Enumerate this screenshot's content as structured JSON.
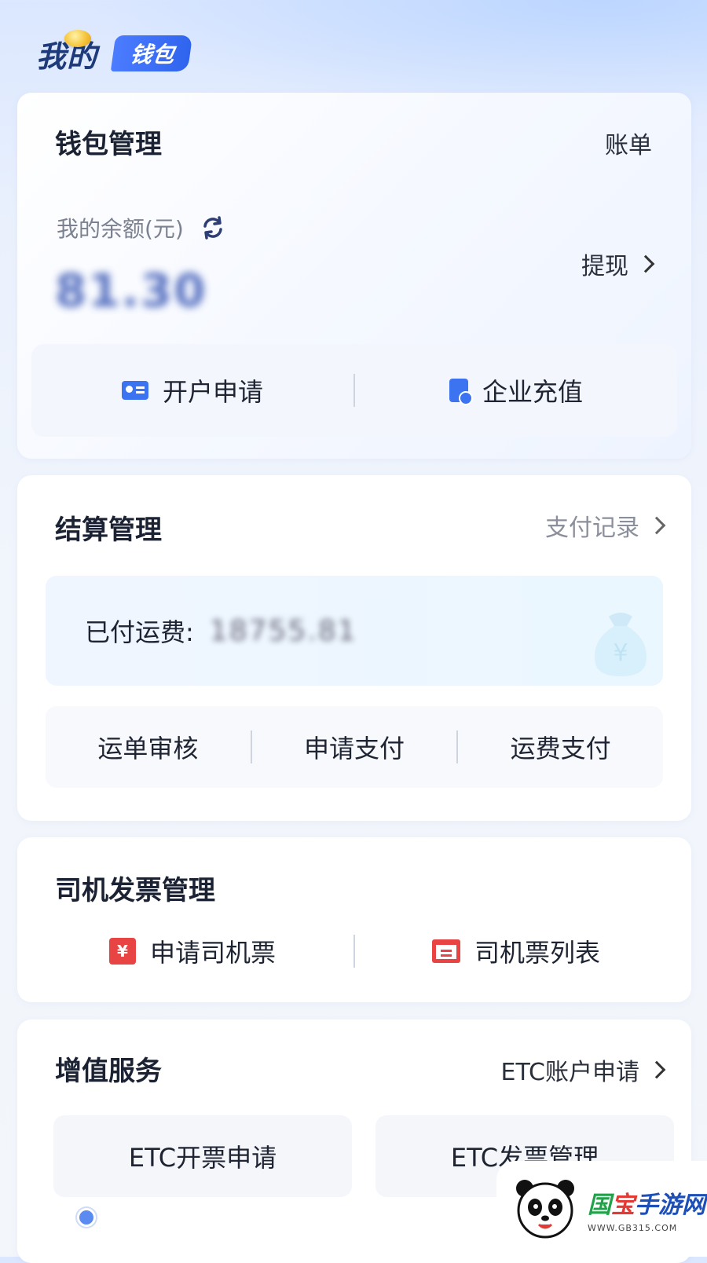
{
  "header": {
    "title": "我的",
    "badge": "钱包"
  },
  "wallet": {
    "title": "钱包管理",
    "bill_link": "账单",
    "balance_label": "我的余额(元)",
    "balance_value": "81.30",
    "withdraw_link": "提现",
    "actions": [
      {
        "label": "开户申请",
        "icon": "id-card-icon"
      },
      {
        "label": "企业充值",
        "icon": "recharge-icon"
      }
    ]
  },
  "settlement": {
    "title": "结算管理",
    "records_link": "支付记录",
    "paid_label": "已付运费:",
    "paid_value": "18755.81",
    "actions": [
      "运单审核",
      "申请支付",
      "运费支付"
    ]
  },
  "invoice": {
    "title": "司机发票管理",
    "actions": [
      {
        "label": "申请司机票",
        "icon": "apply-invoice-icon"
      },
      {
        "label": "司机票列表",
        "icon": "invoice-list-icon"
      }
    ]
  },
  "value_added": {
    "title": "增值服务",
    "etc_link": "ETC账户申请",
    "buttons": [
      "ETC开票申请",
      "ETC发票管理"
    ]
  },
  "watermark": {
    "name_1": "国",
    "name_2": "宝",
    "name_3": "手游网",
    "url": "WWW.GB315.COM"
  },
  "colors": {
    "accent": "#2f64ee",
    "invoice_red": "#e94444",
    "page_bg": "#f1f5fc"
  }
}
